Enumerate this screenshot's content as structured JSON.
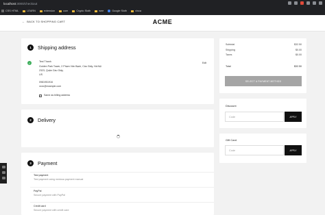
{
  "browser": {
    "url_host": "localhost",
    "url_path": ":3000/checkout",
    "bookmarks": [
      {
        "label": "CSS HTML",
        "icon": "doc-icon"
      },
      {
        "label": "LEARN",
        "icon": "folder-icon"
      },
      {
        "label": "extension",
        "icon": "folder-icon"
      },
      {
        "label": "com",
        "icon": "folder-icon"
      },
      {
        "label": "Crypto Sloth",
        "icon": "folder-icon"
      },
      {
        "label": "wee",
        "icon": "folder-icon"
      },
      {
        "label": "Google Sloth",
        "icon": "google-icon"
      },
      {
        "label": "vinca",
        "icon": "folder-icon"
      }
    ]
  },
  "header": {
    "back_label": "BACK TO SHOPPING CART",
    "logo": "ACME"
  },
  "shipping": {
    "step": "1",
    "title": "Shipping address",
    "edit_label": "Edit",
    "address_lines": [
      "Test Thanh",
      "Golden Park Tower, 2 Phạm Văn Bạch, Cầu Giấy, Hà Nội",
      "2323, Quận Cầu Giấy,",
      "US",
      "",
      "0981951916",
      "xxxx@example.com"
    ],
    "same_as_billing": "Same as billing address"
  },
  "delivery": {
    "step": "2",
    "title": "Delivery"
  },
  "payment": {
    "step": "3",
    "title": "Payment",
    "methods": [
      {
        "name": "Test payment",
        "desc": "Test payment using medusa payment manual"
      },
      {
        "name": "PayPal",
        "desc": "Secure payment with PayPal"
      },
      {
        "name": "Credit card",
        "desc": "Secure payment with credit card"
      }
    ]
  },
  "summary": {
    "rows": [
      {
        "label": "Subtotal",
        "value": "$32.50"
      },
      {
        "label": "Shipping",
        "value": "$0.00"
      },
      {
        "label": "Taxes",
        "value": "$0.00"
      }
    ],
    "total_label": "Total",
    "total_value": "$32.50",
    "select_payment_label": "SELECT A PAYMENT METHOD"
  },
  "discount": {
    "title": "Discount",
    "placeholder": "Code",
    "apply_label": "APPLY"
  },
  "gift_card": {
    "title": "Gift Card",
    "placeholder": "Code",
    "apply_label": "APPLY"
  }
}
